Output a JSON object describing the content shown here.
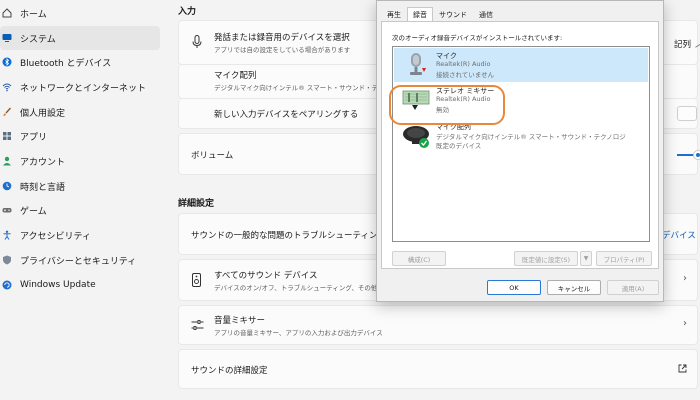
{
  "sidebar": {
    "items": [
      {
        "label": "ホーム",
        "icon": "home-icon",
        "active": false
      },
      {
        "label": "システム",
        "icon": "system-icon",
        "active": true
      },
      {
        "label": "Bluetooth とデバイス",
        "icon": "bluetooth-icon",
        "active": false
      },
      {
        "label": "ネットワークとインターネット",
        "icon": "network-icon",
        "active": false
      },
      {
        "label": "個人用設定",
        "icon": "brush-icon",
        "active": false
      },
      {
        "label": "アプリ",
        "icon": "apps-icon",
        "active": false
      },
      {
        "label": "アカウント",
        "icon": "account-icon",
        "active": false
      },
      {
        "label": "時刻と言語",
        "icon": "clock-icon",
        "active": false
      },
      {
        "label": "ゲーム",
        "icon": "game-icon",
        "active": false
      },
      {
        "label": "アクセシビリティ",
        "icon": "accessibility-icon",
        "active": false
      },
      {
        "label": "プライバシーとセキュリティ",
        "icon": "shield-icon",
        "active": false
      },
      {
        "label": "Windows Update",
        "icon": "update-icon",
        "active": false
      }
    ]
  },
  "main": {
    "input_header": "入力",
    "select_device_title": "発話または録音用のデバイスを選択",
    "select_device_sub": "アプリでは自の設定をしている場合があります",
    "select_device_value": "記列",
    "mic_title": "マイク配列",
    "mic_sub": "デジタルマイク向けインテル® スマート・サウンド・テクノロジ",
    "pair_label": "新しい入力デバイスをペアリングする",
    "volume_label": "ボリューム",
    "advanced_header": "詳細設定",
    "troubleshoot_label": "サウンドの一般的な問題のトラブルシューティング",
    "troubleshoot_value": "デバイス",
    "all_devices_title": "すべてのサウンド デバイス",
    "all_devices_sub": "デバイスのオン/オフ、トラブルシューティング、その他のオプション",
    "mixer_title": "音量ミキサー",
    "mixer_sub": "アプリの音量ミキサー、アプリの入力および出力デバイス",
    "more_settings_label": "サウンドの詳細設定"
  },
  "dialog": {
    "tabs": [
      {
        "label": "再生",
        "active": false
      },
      {
        "label": "録音",
        "active": true
      },
      {
        "label": "サウンド",
        "active": false
      },
      {
        "label": "通信",
        "active": false
      }
    ],
    "description": "次のオーディオ録音デバイスがインストールされています:",
    "devices": [
      {
        "name": "マイク",
        "driver": "Realtek(R) Audio",
        "status": "接続されていません",
        "icon": "microphone-icon",
        "badge": "red-down-arrow",
        "selected": true
      },
      {
        "name": "ステレオ ミキサー",
        "driver": "Realtek(R) Audio",
        "status": "無効",
        "icon": "stereo-mixer-icon",
        "badge": "black-down-arrow",
        "selected": false
      },
      {
        "name": "マイク配列",
        "driver": "デジタルマイク向けインテル® スマート・サウンド・テクノロジ",
        "status": "既定のデバイス",
        "icon": "mic-array-icon",
        "badge": "green-check",
        "selected": false
      }
    ],
    "buttons": {
      "configure": "構成(C)",
      "set_default": "既定値に設定(S)",
      "properties": "プロパティ(P)",
      "ok": "OK",
      "cancel": "キャンセル",
      "apply": "適用(A)"
    }
  },
  "colors": {
    "accent": "#2a78d4",
    "highlight": "#e8883a",
    "selection": "#cde8fb"
  }
}
